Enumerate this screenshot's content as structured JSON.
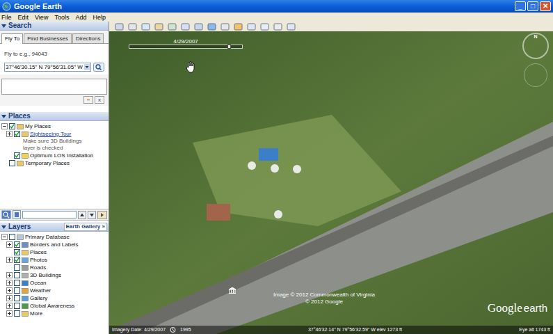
{
  "window": {
    "title": "Google Earth",
    "controls": [
      "_",
      "□",
      "✕"
    ]
  },
  "menu": [
    "File",
    "Edit",
    "View",
    "Tools",
    "Add",
    "Help"
  ],
  "search": {
    "title": "Search",
    "collapse": "▼",
    "tabs": [
      {
        "label": "Fly To",
        "selected": true
      },
      {
        "label": "Find Businesses",
        "selected": false
      },
      {
        "label": "Directions",
        "selected": false
      }
    ],
    "hint": "Fly to e.g., 94043",
    "value": "37°46'30.15\" N 79°56'31.05\" W",
    "close": "x"
  },
  "places": {
    "title": "Places",
    "collapse": "▼",
    "items": [
      {
        "label": "My Places",
        "depth": 0,
        "checked": true,
        "expanded": true,
        "link": false,
        "note": []
      },
      {
        "label": "Sightseeing Tour",
        "depth": 1,
        "checked": true,
        "expanded": false,
        "link": true,
        "note": [
          "Make sure 3D Buildings",
          "layer is checked"
        ]
      },
      {
        "label": "Optimum LOS Installation",
        "depth": 1,
        "checked": true,
        "link": false,
        "note": []
      },
      {
        "label": "Temporary Places",
        "depth": 0,
        "checked": false,
        "link": false,
        "note": []
      }
    ]
  },
  "layers": {
    "title": "Layers",
    "gallery": "Earth Gallery »",
    "items": [
      {
        "label": "Primary Database",
        "depth": 0,
        "checked": false,
        "expanded": true
      },
      {
        "label": "Borders and Labels",
        "depth": 1,
        "checked": true,
        "expanded": false
      },
      {
        "label": "Places",
        "depth": 1,
        "checked": true
      },
      {
        "label": "Photos",
        "depth": 1,
        "checked": true,
        "expanded": false
      },
      {
        "label": "Roads",
        "depth": 1,
        "checked": false
      },
      {
        "label": "3D Buildings",
        "depth": 1,
        "checked": false,
        "expanded": false
      },
      {
        "label": "Ocean",
        "depth": 1,
        "checked": false,
        "expanded": false
      },
      {
        "label": "Weather",
        "depth": 1,
        "checked": false,
        "expanded": false
      },
      {
        "label": "Gallery",
        "depth": 1,
        "checked": false,
        "expanded": false
      },
      {
        "label": "Global Awareness",
        "depth": 1,
        "checked": false,
        "expanded": false
      },
      {
        "label": "More",
        "depth": 1,
        "checked": false,
        "expanded": false
      }
    ]
  },
  "map": {
    "time_slider": "4/29/2007",
    "compass": "N",
    "attribution": [
      "Image © 2012 Commonwealth of Virginia",
      "© 2012 Google"
    ],
    "logo": [
      "Google",
      "earth"
    ],
    "status": {
      "imagery_date": "Imagery Date: 4/29/2007",
      "year": "1995",
      "coords": "37°46'32.14\" N 79°56'32.59\" W elev 1273 ft",
      "eye_alt": "Eye alt 1743 ft"
    }
  }
}
